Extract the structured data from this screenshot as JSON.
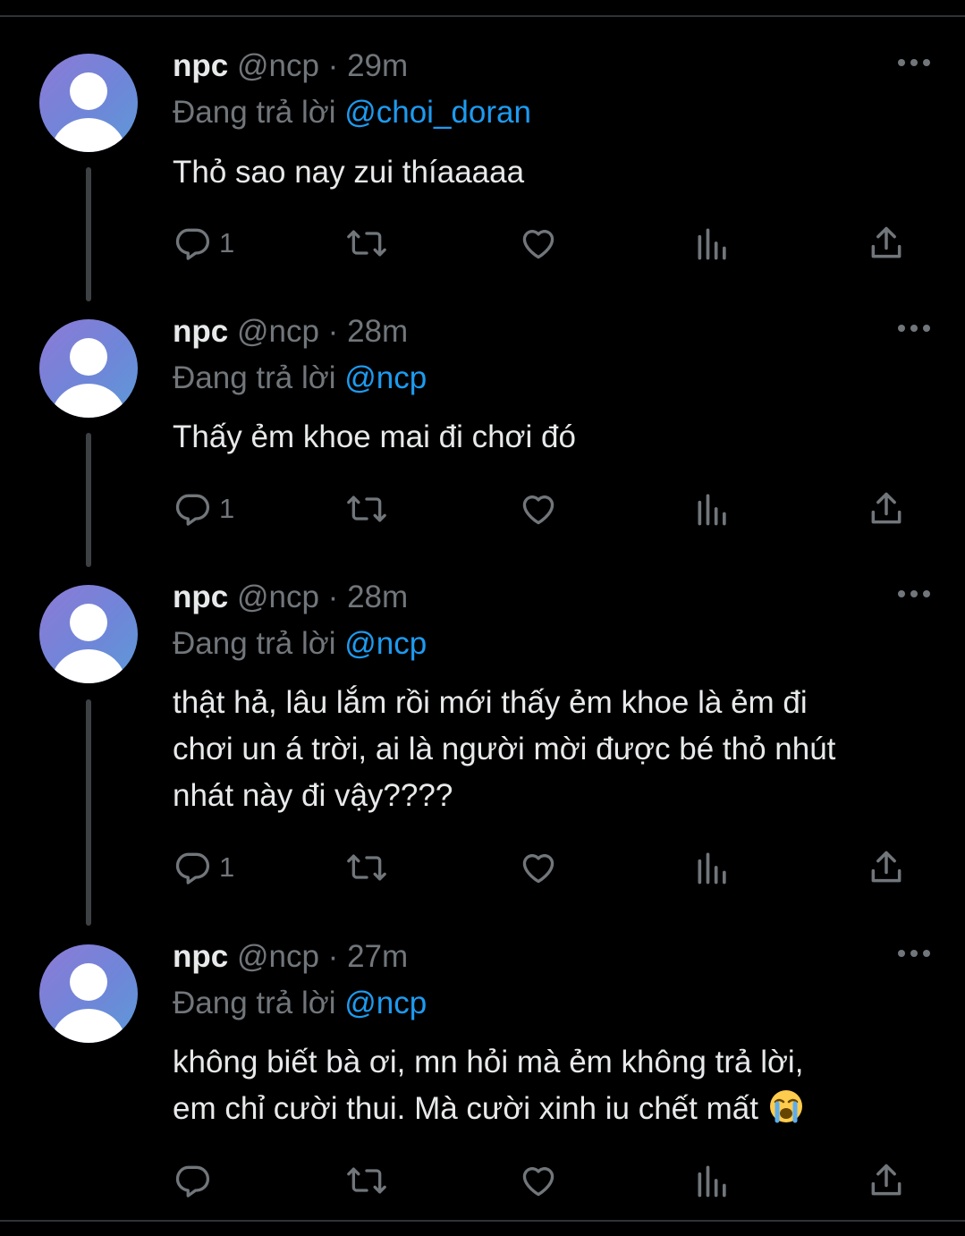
{
  "tweets": [
    {
      "name": "npc",
      "handle": "@ncp",
      "dot": "·",
      "time": "29m",
      "reply_prefix": "Đang trả lời",
      "reply_to": "@choi_doran",
      "lines": [
        "Thỏ sao nay zui thíaaaaa"
      ],
      "reply_count": "1"
    },
    {
      "name": "npc",
      "handle": "@ncp",
      "dot": "·",
      "time": "28m",
      "reply_prefix": "Đang trả lời",
      "reply_to": "@ncp",
      "lines": [
        "Thấy ẻm khoe mai đi chơi đó"
      ],
      "reply_count": "1"
    },
    {
      "name": "npc",
      "handle": "@ncp",
      "dot": "·",
      "time": "28m",
      "reply_prefix": "Đang trả lời",
      "reply_to": "@ncp",
      "lines": [
        "thật hả, lâu lắm rồi mới thấy ẻm khoe là ẻm đi",
        "chơi un á trời, ai là người mời được bé thỏ nhút",
        "nhát này đi vậy????"
      ],
      "reply_count": "1"
    },
    {
      "name": "npc",
      "handle": "@ncp",
      "dot": "·",
      "time": "27m",
      "reply_prefix": "Đang trả lời",
      "reply_to": "@ncp",
      "lines": [
        "không biết bà ơi, mn hỏi mà ẻm không trả lời,",
        "em chỉ cười thui. Mà cười xinh iu chết mất"
      ],
      "emoji": "loudly-crying-face",
      "reply_count": ""
    }
  ],
  "icons": {
    "reply": "speech-bubble-icon",
    "retweet": "retweet-icon",
    "like": "heart-icon",
    "views": "bar-chart-icon",
    "share": "share-upload-icon",
    "more": "more-horizontal-icon"
  },
  "colors": {
    "background": "#000000",
    "text": "#e7e9ea",
    "secondary": "#71767b",
    "link": "#1d9bf0"
  }
}
